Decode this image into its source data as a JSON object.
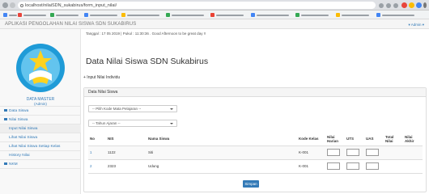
{
  "browser": {
    "url": "localhost/nilaiSDN_sukabirus/form_input_nilai/",
    "colors": {
      "chrome": "#dfe1e5",
      "bookmarks_bar": "#f1f3f4"
    }
  },
  "app": {
    "title": "APLIKASI PENGOLAHAN NILAI SISWA SDN SUKABIRUS",
    "user_menu": "▾ Admin ▾"
  },
  "sidebar": {
    "data_master_title": "DATA MASTER",
    "data_master_sub": "(Admin)",
    "items": [
      {
        "label": "Data Siswa",
        "icon": "users-icon"
      },
      {
        "label": "Nilai Siswa",
        "icon": "table-icon"
      },
      {
        "label": "Input Nilai Siswa",
        "icon": ""
      },
      {
        "label": "Lihat Nilai Siswa",
        "icon": ""
      },
      {
        "label": "Lihat Nilai Siswa Setiap Kelas",
        "icon": ""
      },
      {
        "label": "History Nilai",
        "icon": ""
      },
      {
        "label": "NKM",
        "icon": "bar-icon"
      }
    ]
  },
  "main": {
    "date_line": "Tanggal : 17 05 2019 | Pukul : 11:30:36 . Good Afternoon to be great day !!",
    "page_title": "Data Nilai Siswa SDN Sukabirus",
    "input_link": "+ Input Nilai Individu",
    "panel_title": "Data Nilai Siswa",
    "select_mapel": "-- Pilih Kode Mata Pelajaran --",
    "select_tahun": "-- Tahun Ajaran --",
    "table": {
      "headers": [
        "No",
        "NIS",
        "Nama Siswa",
        "Kode Kelas",
        "Nilai Harian",
        "UTS",
        "UAS",
        "Total Nilai",
        "Nilai Akhir"
      ],
      "rows": [
        {
          "no": "1",
          "nis": "1122",
          "nama": "Siti",
          "kelas": "K-001"
        },
        {
          "no": "2",
          "nis": "2323",
          "nama": "Udung",
          "kelas": "K-001"
        }
      ]
    },
    "save_button": "Simpan",
    "accent_color": "#337ab7"
  }
}
